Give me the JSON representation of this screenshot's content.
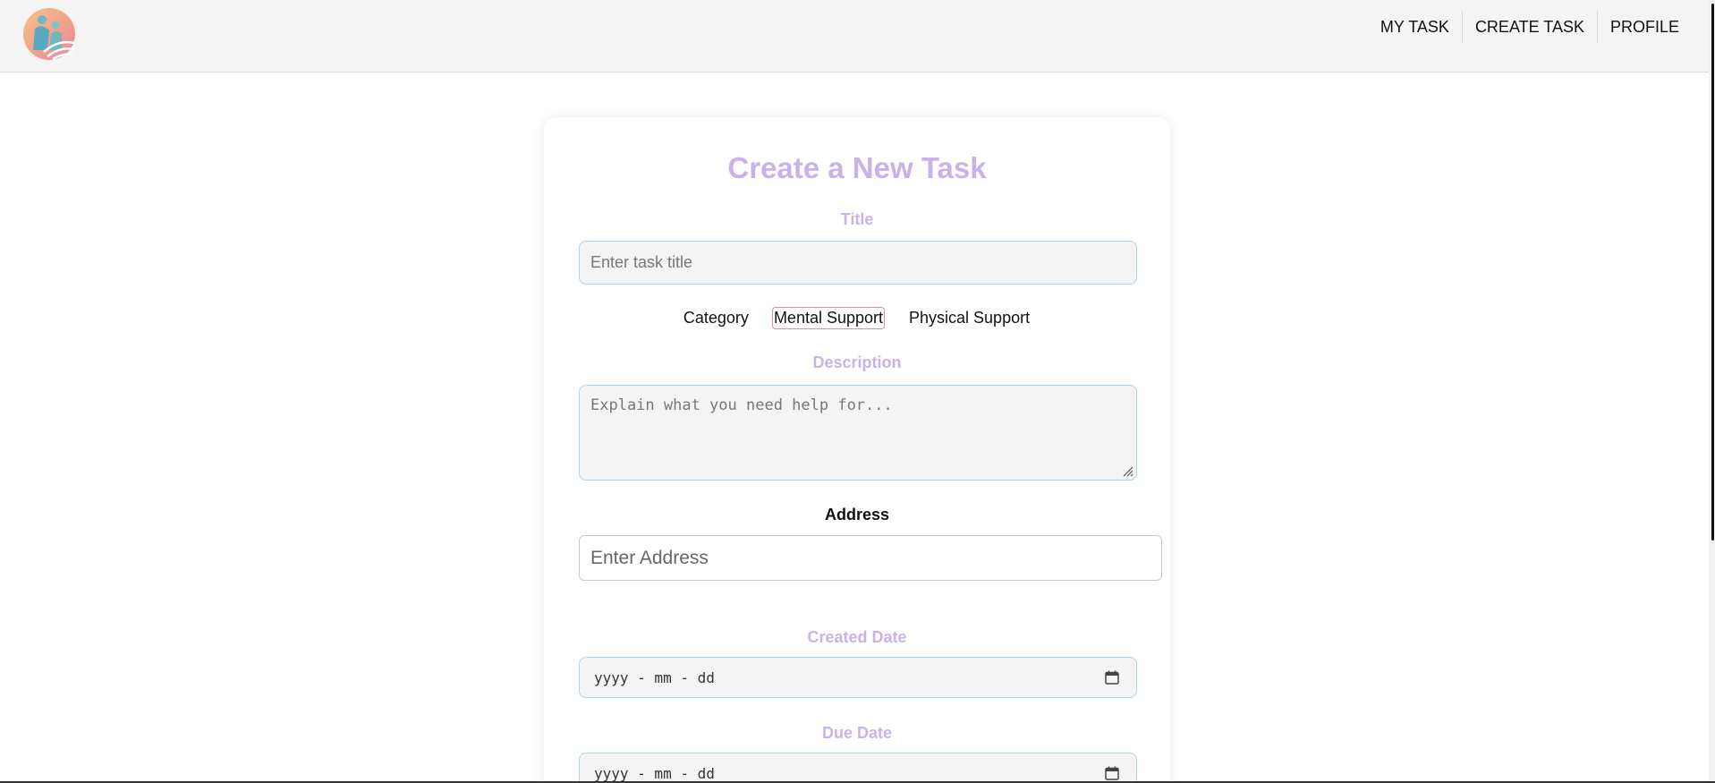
{
  "nav": {
    "items": [
      {
        "label": "MY TASK"
      },
      {
        "label": "CREATE TASK"
      },
      {
        "label": "PROFILE"
      }
    ]
  },
  "form": {
    "title": "Create a New Task",
    "title_field": {
      "label": "Title",
      "placeholder": "Enter task title",
      "value": ""
    },
    "category": {
      "label": "Category",
      "options": [
        "Mental Support",
        "Physical Support"
      ],
      "selected": "Mental Support"
    },
    "description": {
      "label": "Description",
      "placeholder": "Explain what you need help for..."
    },
    "address": {
      "label": "Address",
      "placeholder": "Enter Address"
    },
    "created_date": {
      "label": "Created Date",
      "placeholder": "yyyy - mm - dd"
    },
    "due_date": {
      "label": "Due Date",
      "placeholder": "yyyy - mm - dd"
    }
  },
  "colors": {
    "accent_label": "#c9b3e6",
    "input_border": "#a9d4ee",
    "selected_outline": "#e58aa6",
    "topbar_bg": "#f4f4f4"
  },
  "icons": {
    "logo": "helping-hands-logo-icon",
    "date_picker": "calendar-icon",
    "textarea_resize": "resize-grip-icon"
  }
}
